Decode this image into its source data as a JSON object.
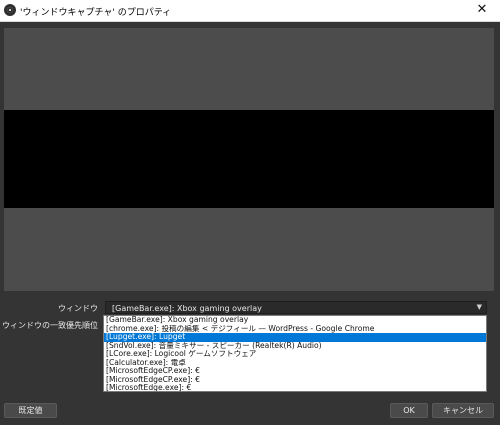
{
  "window": {
    "title": "'ウィンドウキャプチャ' のプロパティ",
    "close_glyph": "✕"
  },
  "form": {
    "window_label": "ウィンドウ",
    "window_value": "[GameBar.exe]: Xbox gaming overlay",
    "priority_label": "ウィンドウの一致優先順位"
  },
  "dropdown": {
    "items": [
      "[GameBar.exe]: Xbox gaming overlay",
      "[chrome.exe]: 投稿の編集 < デジフィール — WordPress - Google Chrome",
      "[Lupget.exe]: Lupget",
      "[SndVol.exe]: 音量ミキサー - スピーカー (Realtek(R) Audio)",
      "[LCore.exe]: Logicool ゲームソフトウェア",
      "[Calculator.exe]: 電卓",
      "[MicrosoftEdgeCP.exe]: €",
      "[MicrosoftEdgeCP.exe]: €",
      "[MicrosoftEdge.exe]: €"
    ],
    "selected_index": 2
  },
  "footer": {
    "defaults_label": "既定値",
    "ok_label": "OK",
    "cancel_label": "キャンセル"
  },
  "icons": {
    "app": "obs-logo-icon",
    "close": "close-icon",
    "combo_arrow": "chevron-down-icon"
  }
}
